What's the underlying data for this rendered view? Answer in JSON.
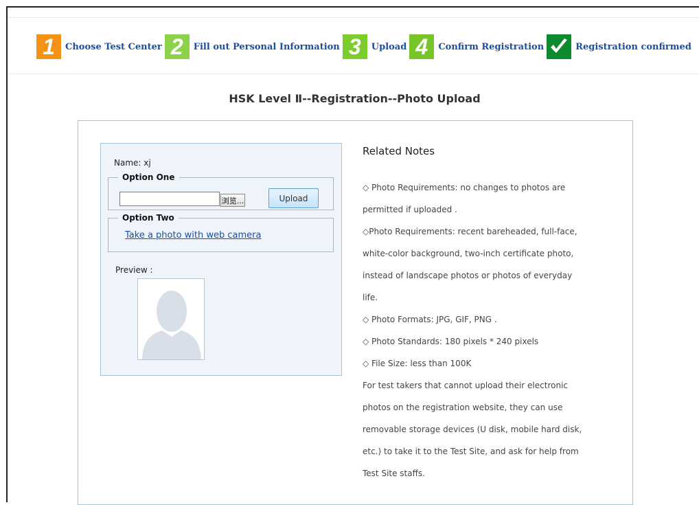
{
  "steps": [
    {
      "num": "1",
      "label": "Choose Test Center",
      "color": "#f39214"
    },
    {
      "num": "2",
      "label": "Fill out Personal Information",
      "color": "#8cd24b"
    },
    {
      "num": "3",
      "label": "Upload",
      "color": "#7ccc2c"
    },
    {
      "num": "4",
      "label": "Confirm Registration",
      "color": "#78c52a"
    },
    {
      "num": "",
      "label": "Registration confirmed",
      "color": "#0d8a2e"
    }
  ],
  "page_title": "HSK Level Ⅱ--Registration--Photo Upload",
  "form": {
    "name_label": "Name:",
    "name_value": "xj",
    "option_one_legend": "Option One",
    "browse_label": "浏览...",
    "upload_label": "Upload",
    "option_two_legend": "Option Two",
    "camera_link": "Take a photo with web camera",
    "preview_label": "Preview :"
  },
  "notes": {
    "title": "Related Notes",
    "lines": [
      "◇ Photo Requirements: no changes to photos are",
      "permitted if uploaded .",
      "◇Photo Requirements: recent bareheaded, full-face,",
      "white-color background, two-inch certificate photo,",
      "instead of landscape photos or photos of everyday",
      "life.",
      "◇ Photo Formats: JPG, GIF, PNG .",
      "◇ Photo Standards: 180 pixels * 240 pixels",
      "◇ File Size: less than 100K",
      "For test takers that cannot upload their electronic",
      "photos on the registration website, they can use",
      "removable storage devices (U disk, mobile hard disk,",
      "etc.) to take it to the Test Site, and ask for help from",
      "Test Site staffs."
    ]
  }
}
